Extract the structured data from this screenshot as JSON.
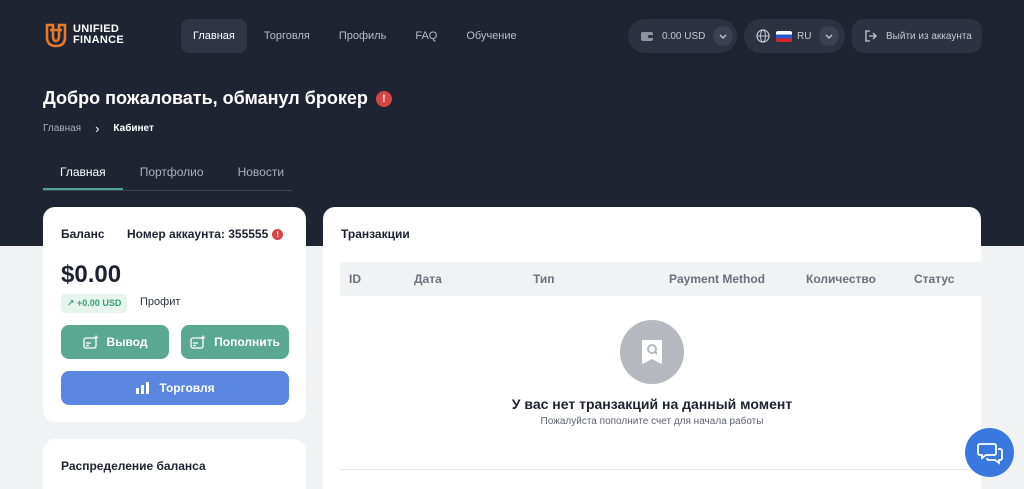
{
  "header": {
    "logo_line1": "UNIFIED",
    "logo_line2": "FINANCE",
    "nav": [
      {
        "label": "Главная",
        "active": true
      },
      {
        "label": "Торговля"
      },
      {
        "label": "Профиль"
      },
      {
        "label": "FAQ"
      },
      {
        "label": "Обучение"
      }
    ],
    "wallet_balance": "0.00 USD",
    "language": "RU",
    "logout_label": "Выйти из аккаунта"
  },
  "hero": {
    "title": "Добро пожаловать, обманул брокер",
    "breadcrumb": {
      "home": "Главная",
      "separator": "›",
      "current": "Кабинет"
    },
    "tabs": [
      {
        "label": "Главная",
        "active": true
      },
      {
        "label": "Портфолио"
      },
      {
        "label": "Новости"
      }
    ]
  },
  "balance": {
    "label": "Баланс",
    "account_label": "Номер аккаунта: 355555",
    "amount": "$0.00",
    "change": "↗ +0.00 USD",
    "change_label": "Профит",
    "withdraw_label": "Вывод",
    "deposit_label": "Пополнить",
    "trade_label": "Торговля"
  },
  "distribution": {
    "title": "Распределение баланса"
  },
  "transactions": {
    "title": "Транзакции",
    "columns": [
      "ID",
      "Дата",
      "Тип",
      "Payment Method",
      "Количество",
      "Статус"
    ],
    "rows": [],
    "empty_title": "У вас нет транзакций на данный момент",
    "empty_subtitle": "Пожалуйста пополните счет для начала работы"
  },
  "colors": {
    "header_bg": "#1e2431",
    "accent_green": "#5aa890",
    "accent_blue": "#5b86e0",
    "logo_orange": "#e8782a",
    "warning_red": "#d64545"
  }
}
